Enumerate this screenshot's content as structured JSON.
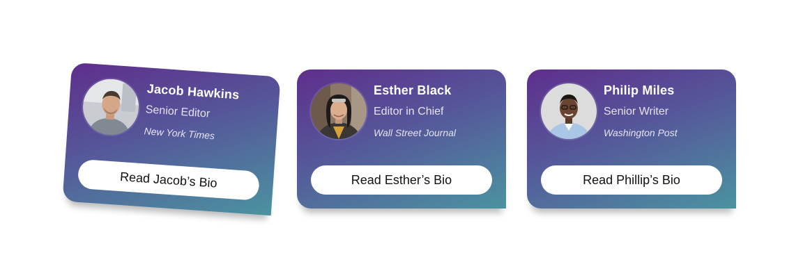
{
  "cards": [
    {
      "name": "Jacob Hawkins",
      "role": "Senior Editor",
      "outlet": "New York Times",
      "button_label": "Read Jacob’s Bio"
    },
    {
      "name": "Esther Black",
      "role": "Editor in Chief",
      "outlet": "Wall Street Journal",
      "button_label": "Read Esther’s Bio"
    },
    {
      "name": "Philip Miles",
      "role": "Senior Writer",
      "outlet": "Washington Post",
      "button_label": "Read Phillip’s Bio"
    }
  ],
  "colors": {
    "gradient_start": "#5f2e8c",
    "gradient_mid": "#55579a",
    "gradient_end": "#4b93a0",
    "button_bg": "#ffffff",
    "button_text": "#111111"
  }
}
